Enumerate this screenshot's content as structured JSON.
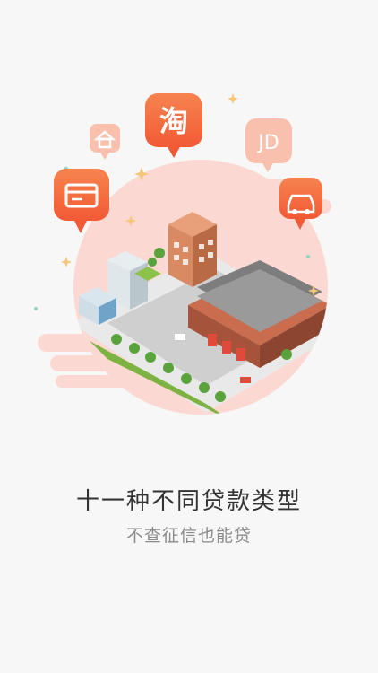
{
  "onboarding": {
    "title": "十一种不同贷款类型",
    "subtitle": "不查征信也能贷"
  },
  "bubbles": {
    "taobao": {
      "label": "淘",
      "icon": "taobao-icon"
    },
    "jd": {
      "label": "JD",
      "icon": "jd-icon"
    },
    "card": {
      "icon": "credit-card-icon"
    },
    "house": {
      "icon": "house-icon"
    },
    "car": {
      "icon": "car-icon"
    }
  },
  "colors": {
    "accent": "#f5663f",
    "accent_light": "#f9b9a3",
    "blush": "#fbd9d2",
    "text_primary": "#333333",
    "text_secondary": "#8a8a8a",
    "background": "#f7f7f7"
  }
}
